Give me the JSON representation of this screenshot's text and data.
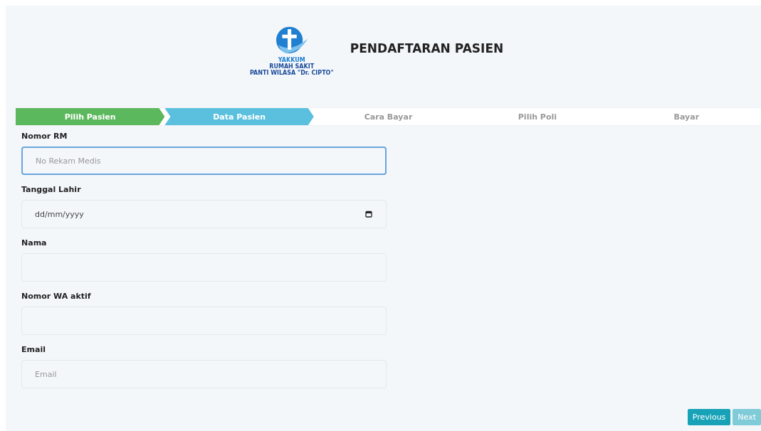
{
  "header": {
    "logo": {
      "arc_text": "YAKKUM",
      "line_1": "RUMAH SAKIT",
      "line_2": "PANTI WILASA \"Dr. CIPTO\""
    },
    "title": "PENDAFTARAN PASIEN"
  },
  "steps": [
    {
      "label": "Pilih Pasien",
      "completed": true,
      "selected": false
    },
    {
      "label": "Data Pasien",
      "completed": false,
      "selected": true
    },
    {
      "label": "Cara Bayar",
      "completed": false,
      "selected": false
    },
    {
      "label": "Pilih Poli",
      "completed": false,
      "selected": false
    },
    {
      "label": "Bayar",
      "completed": false,
      "selected": false
    }
  ],
  "fields": [
    {
      "label": "Nomor RM",
      "kind": "text",
      "placeholder": "No Rekam Medis",
      "focused": true
    },
    {
      "label": "Tanggal Lahir",
      "kind": "date",
      "placeholder": "dd/mm/yyyy",
      "focused": false
    },
    {
      "label": "Nama",
      "kind": "text",
      "focused": false
    },
    {
      "label": "Nomor WA aktif",
      "kind": "text",
      "focused": false
    },
    {
      "label": "Email",
      "kind": "text",
      "placeholder": "Email",
      "focused": false
    }
  ],
  "buttons": [
    {
      "label": "Previous",
      "disabled": false
    },
    {
      "label": "Next",
      "disabled": true
    }
  ]
}
